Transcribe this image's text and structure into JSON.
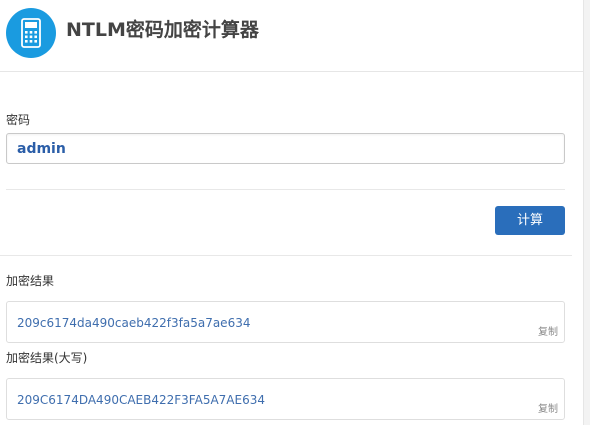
{
  "header": {
    "title": "NTLM密码加密计算器",
    "icon": "calculator-icon",
    "icon_bg_color": "#1a9be0"
  },
  "form": {
    "password_label": "密码",
    "password_value": "admin",
    "calculate_label": "计算",
    "button_color": "#2a6ebb"
  },
  "results": [
    {
      "label": "加密结果",
      "value": "209c6174da490caeb422f3fa5a7ae634",
      "copy_label": "复制"
    },
    {
      "label": "加密结果(大写)",
      "value": "209C6174DA490CAEB422F3FA5A7AE634",
      "copy_label": "复制"
    }
  ]
}
